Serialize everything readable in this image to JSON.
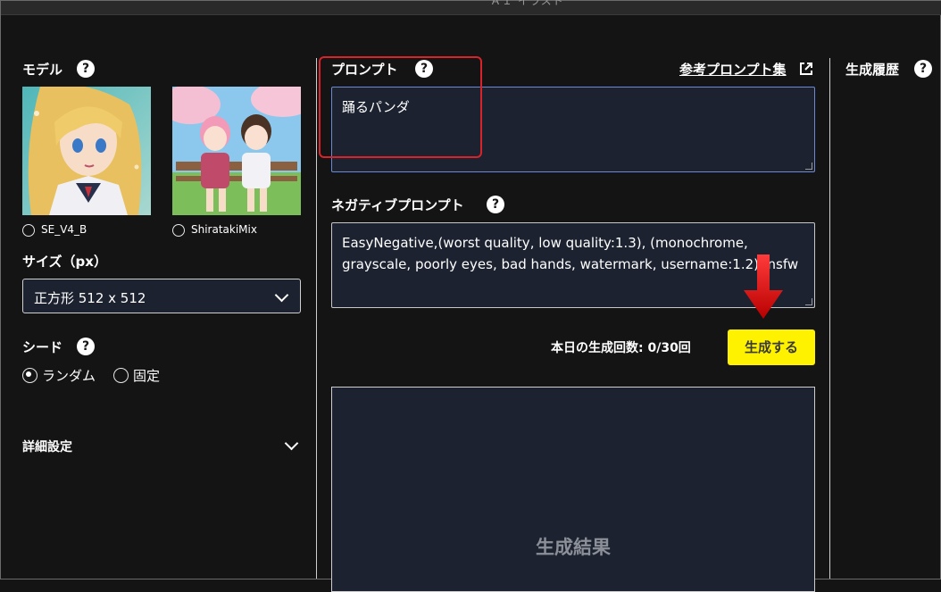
{
  "topbar": {
    "cut_title": "ＡＩ イラスト"
  },
  "left": {
    "model_label": "モデル",
    "models": [
      {
        "name": "SE_V4_B",
        "selected": false
      },
      {
        "name": "ShiratakiMix",
        "selected": false
      }
    ],
    "size_label": "サイズ（px）",
    "size_value": "正方形 512 x 512",
    "seed_label": "シード",
    "seed_options": [
      {
        "label": "ランダム",
        "selected": true
      },
      {
        "label": "固定",
        "selected": false
      }
    ],
    "advanced_label": "詳細設定"
  },
  "center": {
    "prompt_label": "プロンプト",
    "prompt_link": "参考プロンプト集",
    "prompt_value": "踊るパンダ",
    "negative_label": "ネガティブプロンプト",
    "negative_value": "EasyNegative,(worst quality, low quality:1.3), (monochrome, grayscale, poorly eyes, bad hands, watermark, username:1.2), nsfw",
    "count_text": "本日の生成回数: 0/30回",
    "generate_button": "生成する",
    "result_label": "生成結果"
  },
  "right": {
    "history_label": "生成履歴"
  },
  "help_glyph": "?",
  "colors": {
    "accent_button": "#fff200",
    "highlight_box": "#d9232a",
    "arrow": "#cc1111",
    "field_bg": "#1c2230"
  }
}
